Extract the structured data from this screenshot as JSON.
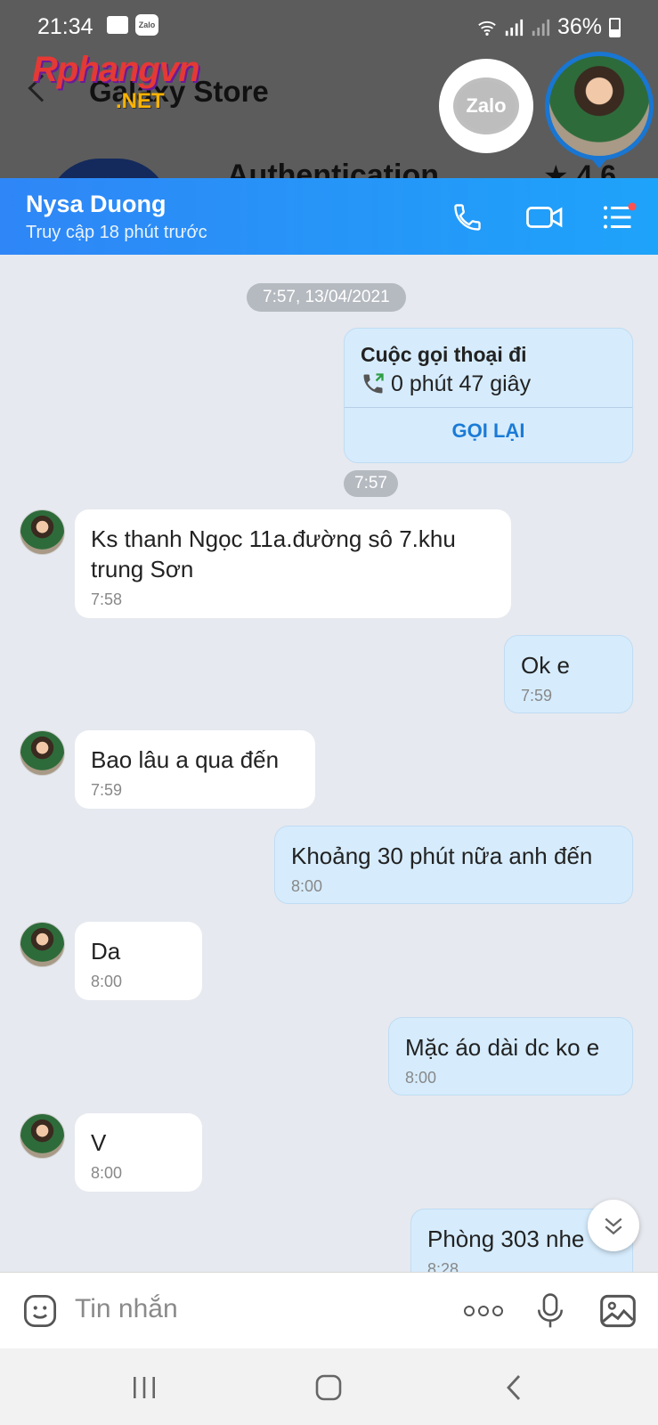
{
  "status_bar": {
    "time": "21:34",
    "notif_app": "Zalo",
    "battery": "36%"
  },
  "background_app": {
    "watermark_main": "Rphangvn",
    "watermark_sub": ".NET",
    "title": "Galaxy Store",
    "app_name": "Authentication",
    "rating": "★ 4.6"
  },
  "floating": {
    "zalo_label": "Zalo"
  },
  "header": {
    "contact_name": "Nysa Duong",
    "last_seen": "Truy cập 18 phút trước"
  },
  "conversation": {
    "date_stamp": "7:57, 13/04/2021",
    "call_card": {
      "title": "Cuộc gọi thoại đi",
      "duration": "0 phút 47 giây",
      "action": "GỌI LẠI",
      "time": "7:57"
    },
    "messages": [
      {
        "dir": "in",
        "text": "Ks thanh Ngọc 11a.đường sô 7.khu trung Sơn",
        "time": "7:58"
      },
      {
        "dir": "out",
        "text": "Ok e",
        "time": "7:59"
      },
      {
        "dir": "in",
        "text": "Bao lâu a qua đến",
        "time": "7:59"
      },
      {
        "dir": "out",
        "text": "Khoảng 30 phút nữa anh đến",
        "time": "8:00"
      },
      {
        "dir": "in",
        "text": "Da",
        "time": "8:00"
      },
      {
        "dir": "out",
        "text": "Mặc áo dài dc ko e",
        "time": "8:00"
      },
      {
        "dir": "in",
        "text": "V",
        "time": "8:00"
      },
      {
        "dir": "out",
        "text": "Phòng 303 nhe",
        "time": "8:28"
      }
    ]
  },
  "input": {
    "placeholder": "Tin nhắn"
  },
  "colors": {
    "header_start": "#2f86f6",
    "header_end": "#1ea3fa",
    "outgoing_bubble": "#d6ecfd",
    "incoming_bubble": "#ffffff",
    "accent_link": "#1b7bd6",
    "chat_background": "#e6e9ef"
  }
}
